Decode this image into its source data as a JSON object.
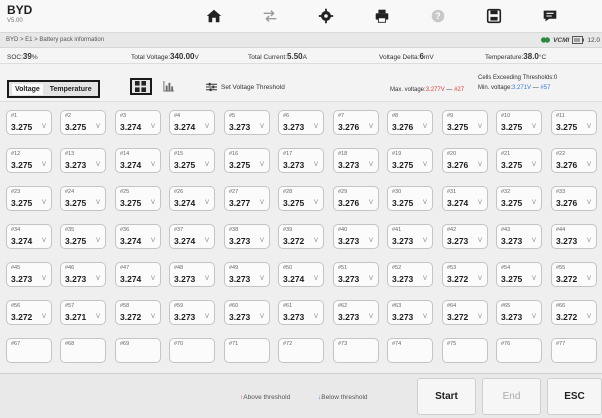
{
  "app": {
    "name": "BYD",
    "version": "V5.00"
  },
  "toolbar": [
    {
      "name": "home-button",
      "icon": "home-icon"
    },
    {
      "name": "vehicle-swap-button",
      "icon": "car-swap-icon"
    },
    {
      "name": "settings-button",
      "icon": "gear-icon"
    },
    {
      "name": "print-button",
      "icon": "printer-icon"
    },
    {
      "name": "help-button",
      "icon": "help-icon"
    },
    {
      "name": "save-button",
      "icon": "save-icon"
    },
    {
      "name": "message-button",
      "icon": "chat-icon"
    }
  ],
  "breadcrumb": {
    "path": "BYD > E1 > Battery pack information",
    "vci_label": "VCMI",
    "value": "12.0"
  },
  "info": {
    "soc_label": "SOC:",
    "soc_value": "39",
    "soc_unit": "%",
    "voltage_label": "Total Voltage:",
    "voltage_value": "340.00",
    "voltage_unit": "V",
    "current_label": "Total Current:",
    "current_value": "5.50",
    "current_unit": "A",
    "delta_label": "Voltage Delta:",
    "delta_value": "6",
    "delta_unit": "mV",
    "temp_label": "Temperature:",
    "temp_value": "38.0",
    "temp_unit": "°C"
  },
  "controls": {
    "tab_voltage": "Voltage",
    "tab_temperature": "Temperature",
    "set_threshold": "Set Voltage Threshold",
    "cells_exceeding": "Cells Exceeding Thresholds:0",
    "max_label": "Max. voltage:",
    "max_value": "3.277V",
    "max_sep": " — ",
    "max_cell": "#27",
    "min_label": "Min. voltage:",
    "min_value": "3.271V",
    "min_sep": " — ",
    "min_cell": "#57"
  },
  "unit": "V",
  "cells": [
    "3.275",
    "3.275",
    "3.274",
    "3.274",
    "3.273",
    "3.273",
    "3.276",
    "3.276",
    "3.275",
    "3.275",
    "3.275",
    "3.275",
    "3.273",
    "3.274",
    "3.275",
    "3.275",
    "3.273",
    "3.273",
    "3.275",
    "3.276",
    "3.275",
    "3.276",
    "3.275",
    "3.275",
    "3.275",
    "3.274",
    "3.277",
    "3.275",
    "3.276",
    "3.275",
    "3.274",
    "3.275",
    "3.276",
    "3.274",
    "3.275",
    "3.274",
    "3.274",
    "3.273",
    "3.272",
    "3.273",
    "3.273",
    "3.273",
    "3.273",
    "3.273",
    "3.273",
    "3.273",
    "3.274",
    "3.273",
    "3.273",
    "3.274",
    "3.273",
    "3.273",
    "3.272",
    "3.275",
    "3.272",
    "3.272",
    "3.271",
    "3.272",
    "3.273",
    "3.273",
    "3.273",
    "3.273",
    "3.273",
    "3.272",
    "3.273",
    "3.272",
    "",
    "",
    "",
    "",
    "",
    "",
    "",
    "",
    "",
    "",
    ""
  ],
  "footer": {
    "above_label": "Above threshold",
    "below_label": "Below threshold",
    "start_label": "Start",
    "end_label": "End",
    "esc_label": "ESC"
  }
}
